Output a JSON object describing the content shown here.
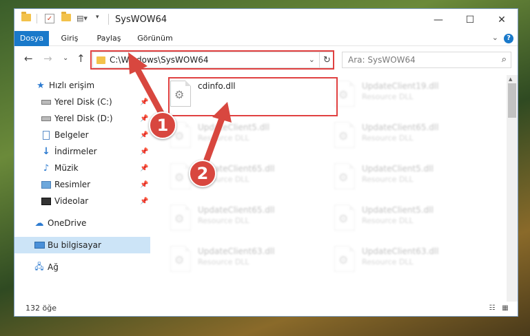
{
  "window": {
    "title": "SysWOW64"
  },
  "ribbon": {
    "tabs": [
      "Dosya",
      "Giriş",
      "Paylaş",
      "Görünüm"
    ],
    "help": "?"
  },
  "address": {
    "path": "C:\\Windows\\SysWOW64"
  },
  "search": {
    "placeholder": "Ara: SysWOW64"
  },
  "sidebar": {
    "quick_access": "Hızlı erişim",
    "items": [
      "Yerel Disk (C:)",
      "Yerel Disk (D:)",
      "Belgeler",
      "İndirmeler",
      "Müzik",
      "Resimler",
      "Videolar"
    ],
    "onedrive": "OneDrive",
    "this_pc": "Bu bilgisayar",
    "network": "Ağ"
  },
  "files": [
    {
      "name": "cdinfo.dll",
      "type": "",
      "blur": false
    },
    {
      "name": "UpdateClient19.dll",
      "type": "Resource DLL",
      "blur": true
    },
    {
      "name": "UpdateClient5.dll",
      "type": "Resource DLL",
      "blur": true
    },
    {
      "name": "UpdateClient65.dll",
      "type": "Resource DLL",
      "blur": true
    },
    {
      "name": "UpdateClient65.dll",
      "type": "Resource DLL",
      "blur": true
    },
    {
      "name": "UpdateClient5.dll",
      "type": "Resource DLL",
      "blur": true
    },
    {
      "name": "UpdateClient65.dll",
      "type": "Resource DLL",
      "blur": true
    },
    {
      "name": "UpdateClient5.dll",
      "type": "Resource DLL",
      "blur": true
    },
    {
      "name": "UpdateClient63.dll",
      "type": "Resource DLL",
      "blur": true
    },
    {
      "name": "UpdateClient63.dll",
      "type": "Resource DLL",
      "blur": true
    }
  ],
  "status": {
    "count": "132 öğe"
  },
  "callouts": {
    "one": "1",
    "two": "2"
  },
  "colors": {
    "accent": "#1979ca",
    "highlight": "#e04040",
    "badge": "#d8473f",
    "selected": "#cce4f7"
  }
}
